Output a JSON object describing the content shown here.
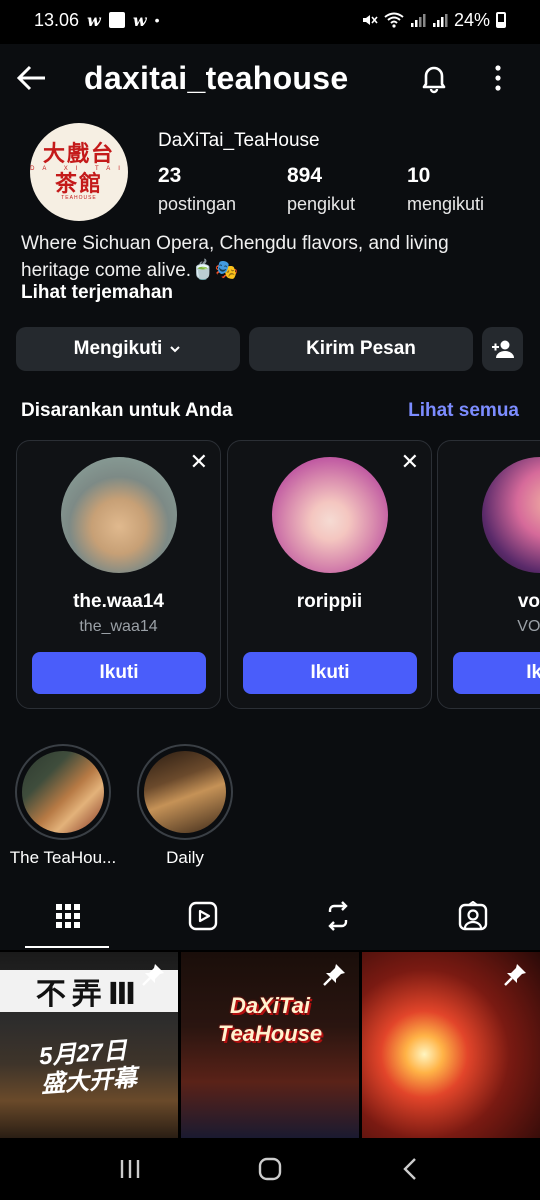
{
  "status_bar": {
    "time": "13.06",
    "left_icons": [
      "w-app-icon",
      "shop-icon",
      "w-app-icon",
      "dot-icon"
    ],
    "battery": "24%",
    "right_icons": [
      "mute-icon",
      "wifi-icon",
      "signal-icon",
      "signal-icon",
      "battery-icon"
    ]
  },
  "header": {
    "username": "daxitai_teahouse",
    "back_icon": "arrow-left-icon",
    "bell_icon": "bell-icon",
    "menu_icon": "more-vertical-icon"
  },
  "profile": {
    "display_name": "DaXiTai_TeaHouse",
    "avatar_logo": {
      "top": "大戲台",
      "middle": "DA  XI  TAI",
      "bottom": "茶館",
      "sub": "TEAHOUSE"
    },
    "stats": [
      {
        "value": "23",
        "label": "postingan"
      },
      {
        "value": "894",
        "label": "pengikut"
      },
      {
        "value": "10",
        "label": "mengikuti"
      }
    ],
    "bio": "Where Sichuan Opera, Chengdu flavors, and living heritage come alive.🍵🎭",
    "translate_label": "Lihat terjemahan"
  },
  "actions": {
    "following_label": "Mengikuti",
    "message_label": "Kirim Pesan"
  },
  "suggested": {
    "title": "Disarankan untuk Anda",
    "see_all": "Lihat semua",
    "cards": [
      {
        "name": "the.waa14",
        "handle": "the_waa14",
        "button": "Ikuti"
      },
      {
        "name": "rorippii",
        "handle": "",
        "button": "Ikuti"
      },
      {
        "name": "voss",
        "handle": "VOSS",
        "button": "Iku"
      }
    ]
  },
  "highlights": [
    {
      "label": "The TeaHou..."
    },
    {
      "label": "Daily"
    }
  ],
  "tabs": [
    "grid-icon",
    "reels-icon",
    "reposts-icon",
    "tagged-icon"
  ],
  "posts": [
    {
      "banner": "不弄Ⅲ",
      "text_line1": "5月27日",
      "text_line2": "盛大开幕",
      "pinned": true
    },
    {
      "text_line1": "DaXiTai",
      "text_line2": "TeaHouse",
      "pinned": true
    },
    {
      "pinned": true
    }
  ],
  "colors": {
    "background": "#0b0d10",
    "button": "#25292e",
    "accent_link": "#7c8cff",
    "follow_button": "#4a5dfa"
  }
}
